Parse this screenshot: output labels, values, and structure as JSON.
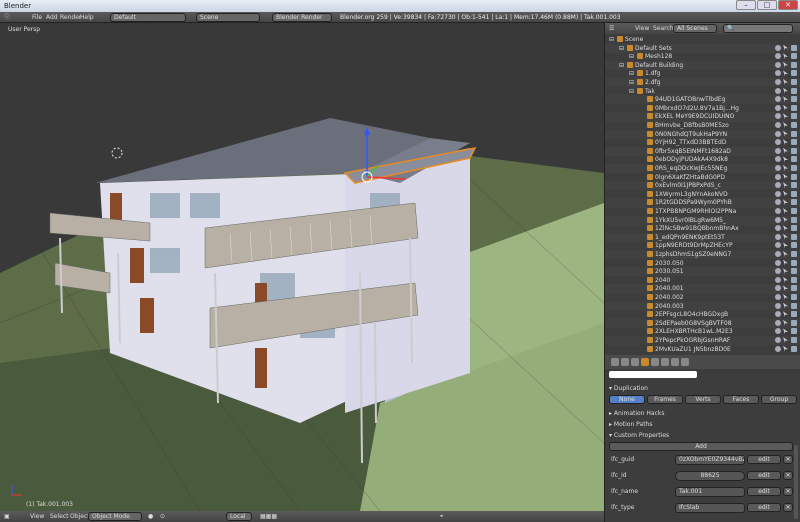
{
  "window": {
    "title": "Blender"
  },
  "menu": {
    "file": "File",
    "add": "Add",
    "render": "Render",
    "help": "Help",
    "screen": "Default",
    "scene": "Scene",
    "engine": "Blender Render",
    "stats": "Blender.org 259 | Ve:39834 | Fa:72730 | Ob:1-541 | La:1 | Mem:17.46M (0.88M) | Tak.001.003"
  },
  "viewport": {
    "label": "User Persp",
    "object_label": "(1) Tak.001.003"
  },
  "vpheader": {
    "view": "View",
    "select": "Select",
    "object": "Object",
    "mode": "Object Mode",
    "space": "Local"
  },
  "outliner": {
    "view": "View",
    "search": "Search",
    "scene_filter": "All Scenes",
    "rows": [
      {
        "t": "Scene",
        "d": 0
      },
      {
        "t": "Default Sets",
        "d": 1
      },
      {
        "t": "Mesh128",
        "d": 2
      },
      {
        "t": "Default Building",
        "d": 1
      },
      {
        "t": "1.dfg",
        "d": 2
      },
      {
        "t": "2.dfg",
        "d": 2
      },
      {
        "t": "Tak",
        "d": 2
      },
      {
        "t": "94UD1GATOBnwTlbdEg",
        "d": 3
      },
      {
        "t": "0MbrxdO7d2U.8V7a1Bj...Hg",
        "d": 3
      },
      {
        "t": "EkXEL MeY9E9DCUIDUINO",
        "d": 3
      },
      {
        "t": "BHmvbe_DBfbsB0ME5zo",
        "d": 3
      },
      {
        "t": "0N0NGhdQT9ukHaP9YN",
        "d": 3
      },
      {
        "t": "0YjH92_TTxdD3BBTEdD",
        "d": 3
      },
      {
        "t": "0fbr5xqB5EINMFt1682aD",
        "d": 3
      },
      {
        "t": "0ebODyjPUDAkA4X9dk8",
        "d": 3
      },
      {
        "t": "0RS_eqDDcKwJEc55NEg",
        "d": 3
      },
      {
        "t": "0lgn6XaKfZHtaBdG0PD",
        "d": 3
      },
      {
        "t": "0xEvlm0I1JPBPxPdS_c",
        "d": 3
      },
      {
        "t": "1XWyrmL3gNYnAkoNVD",
        "d": 3
      },
      {
        "t": "1R2tGDDSPa9Wym0PYhB",
        "d": 3
      },
      {
        "t": "1TXPBBNPGM9RHlOI2PPNa",
        "d": 3
      },
      {
        "t": "1YkXU5vr0lBLgRw6M5_",
        "d": 3
      },
      {
        "t": "1ZlNcSBw91BQBbnmBhnAx",
        "d": 3
      },
      {
        "t": "1_edQPn9ENK9ptEt53T",
        "d": 3
      },
      {
        "t": "1ppN9ERDt9DrMpZHEcYP",
        "d": 3
      },
      {
        "t": "1zphsDhmS1gSZ0eNNG7",
        "d": 3
      },
      {
        "t": "2030.050",
        "d": 3
      },
      {
        "t": "2030.051",
        "d": 3
      },
      {
        "t": "2040",
        "d": 3
      },
      {
        "t": "2040.001",
        "d": 3
      },
      {
        "t": "2040.002",
        "d": 3
      },
      {
        "t": "2040.003",
        "d": 3
      },
      {
        "t": "2EPFsgcL8O4cHBGDxgB",
        "d": 3
      },
      {
        "t": "2SdEPaeb0G8VSgBVTF08",
        "d": 3
      },
      {
        "t": "2XLEHXBRTHcB1wL.M2E3",
        "d": 3
      },
      {
        "t": "2YPepcPkOGRbjGsnHRAF",
        "d": 3
      },
      {
        "t": "2MvKUaZU1 JN5bnzBD0E",
        "d": 3
      }
    ]
  },
  "props": {
    "duplication": "Duplication",
    "dup_buttons": [
      "None",
      "Frames",
      "Verts",
      "Faces",
      "Group"
    ],
    "animation_hacks": "Animation Hacks",
    "motion_paths": "Motion Paths",
    "custom_properties": "Custom Properties",
    "add": "Add",
    "fields": [
      {
        "label": "ifc_guid",
        "value": "0zXObmYE0Z9344vBZsKh",
        "btn": "edit"
      },
      {
        "label": "ifc_id",
        "value": "88625",
        "btn": "edit"
      },
      {
        "label": "ifc_name",
        "value": "Tak.001",
        "btn": "edit"
      },
      {
        "label": "ifc_type",
        "value": "IfcSlab",
        "btn": "edit"
      }
    ]
  }
}
